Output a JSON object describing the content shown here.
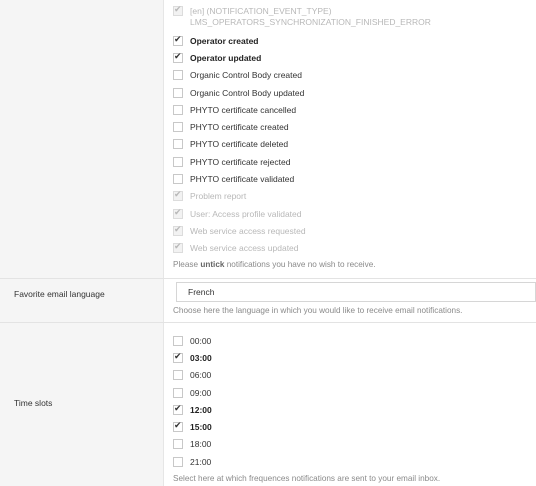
{
  "notifications": {
    "items": [
      {
        "label": "[en] (NOTIFICATION_EVENT_TYPE)",
        "label2": "LMS_OPERATORS_SYNCHRONIZATION_FINISHED_ERROR",
        "checked": true,
        "disabled": true,
        "bold": false
      },
      {
        "label": "Operator created",
        "checked": true,
        "disabled": false,
        "bold": true
      },
      {
        "label": "Operator updated",
        "checked": true,
        "disabled": false,
        "bold": true
      },
      {
        "label": "Organic Control Body created",
        "checked": false,
        "disabled": false,
        "bold": false
      },
      {
        "label": "Organic Control Body updated",
        "checked": false,
        "disabled": false,
        "bold": false
      },
      {
        "label": "PHYTO certificate cancelled",
        "checked": false,
        "disabled": false,
        "bold": false
      },
      {
        "label": "PHYTO certificate created",
        "checked": false,
        "disabled": false,
        "bold": false
      },
      {
        "label": "PHYTO certificate deleted",
        "checked": false,
        "disabled": false,
        "bold": false
      },
      {
        "label": "PHYTO certificate rejected",
        "checked": false,
        "disabled": false,
        "bold": false
      },
      {
        "label": "PHYTO certificate validated",
        "checked": false,
        "disabled": false,
        "bold": false
      },
      {
        "label": "Problem report",
        "checked": true,
        "disabled": true,
        "bold": false
      },
      {
        "label": "User: Access profile validated",
        "checked": true,
        "disabled": true,
        "bold": false
      },
      {
        "label": "Web service access requested",
        "checked": true,
        "disabled": true,
        "bold": false
      },
      {
        "label": "Web service access updated",
        "checked": true,
        "disabled": true,
        "bold": false
      }
    ],
    "help_prefix": "Please ",
    "help_bold": "untick",
    "help_suffix": " notifications you have no wish to receive."
  },
  "email_language": {
    "label": "Favorite email language",
    "value": "French",
    "help": "Choose here the language in which you would like to receive email notifications."
  },
  "time_slots": {
    "label": "Time slots",
    "slots": [
      {
        "label": "00:00",
        "checked": false
      },
      {
        "label": "03:00",
        "checked": true
      },
      {
        "label": "06:00",
        "checked": false
      },
      {
        "label": "09:00",
        "checked": false
      },
      {
        "label": "12:00",
        "checked": true
      },
      {
        "label": "15:00",
        "checked": true
      },
      {
        "label": "18:00",
        "checked": false
      },
      {
        "label": "21:00",
        "checked": false
      }
    ],
    "help": "Select here at which frequences notifications are sent to your email inbox."
  }
}
